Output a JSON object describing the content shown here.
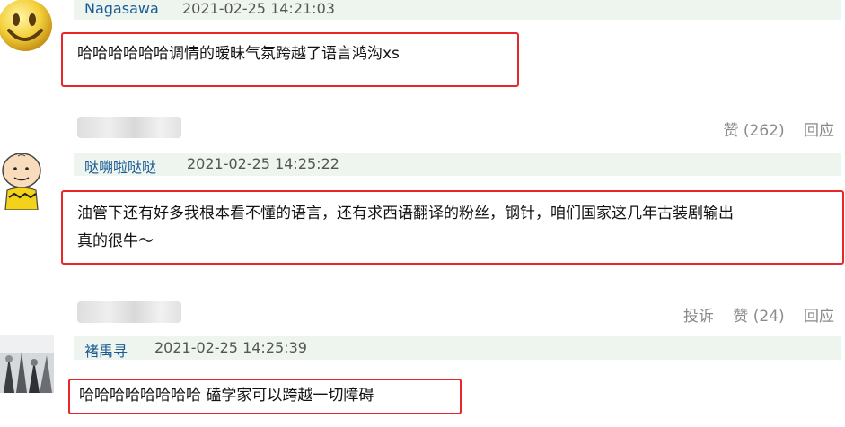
{
  "comments": [
    {
      "username": "Nagasawa",
      "time": "2021-02-25 14:21:03",
      "text": "哈哈哈哈哈哈调情的暧昧气氛跨越了语言鸿沟xs",
      "actions": {
        "like_label": "赞",
        "like_count": "(262)",
        "reply": "回应"
      }
    },
    {
      "username": "哒嗍啦哒哒",
      "time": "2021-02-25 14:25:22",
      "text_line1": "油管下还有好多我根本看不懂的语言，还有求西语翻译的粉丝，钢针，咱们国家这几年古装剧输出",
      "text_line2": "真的很牛～",
      "actions": {
        "report": "投诉",
        "like_label": "赞",
        "like_count": "(24)",
        "reply": "回应"
      }
    },
    {
      "username": "褚禹寻",
      "time": "2021-02-25 14:25:39",
      "text": "哈哈哈哈哈哈哈哈 磕学家可以跨越一切障碍"
    }
  ],
  "colors": {
    "highlight_border": "#e8262c",
    "username": "#1a5c96",
    "header_bg": "#eef4ee",
    "action_text": "#8a8a8a"
  }
}
